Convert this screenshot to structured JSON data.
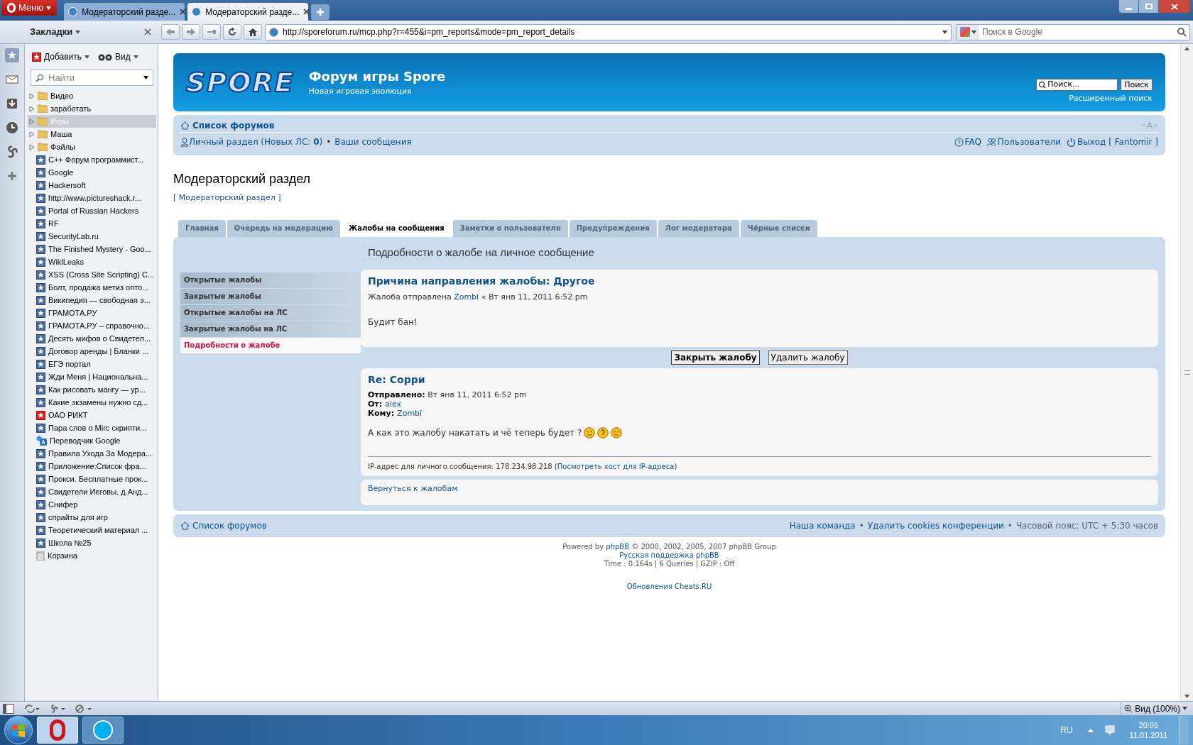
{
  "browser": {
    "menu": "Меню",
    "tabs": [
      {
        "title": "Модераторский разде...",
        "selected": false
      },
      {
        "title": "Модераторский разде...",
        "selected": true
      }
    ],
    "address": "http://sporeforum.ru/mcp.php?r=455&i=pm_reports&mode=pm_report_details",
    "search_placeholder": "Поиск в Google"
  },
  "sidebar": {
    "title": "Закладки",
    "add": "Добавить",
    "view": "Вид",
    "search_placeholder": "Найти",
    "items": [
      {
        "kind": "folder",
        "label": "Видео",
        "selected": false
      },
      {
        "kind": "folder",
        "label": "заработать",
        "selected": false
      },
      {
        "kind": "folder",
        "label": "Игры",
        "selected": true
      },
      {
        "kind": "folder",
        "label": "Маша",
        "selected": false
      },
      {
        "kind": "folder",
        "label": "Файлы",
        "selected": false
      },
      {
        "kind": "bookmark",
        "label": "C++ Форум программист...",
        "selected": false
      },
      {
        "kind": "bookmark",
        "label": "Google",
        "selected": false
      },
      {
        "kind": "bookmark",
        "label": "Hackersoft",
        "selected": false
      },
      {
        "kind": "bookmark",
        "label": "http://www.pictureshack.r...",
        "selected": false
      },
      {
        "kind": "bookmark",
        "label": "Portal of Russian Hackers",
        "selected": false
      },
      {
        "kind": "bookmark",
        "label": "RF",
        "selected": false
      },
      {
        "kind": "bookmark",
        "label": "SecurityLab.ru",
        "selected": false
      },
      {
        "kind": "bookmark",
        "label": "The Finished Mystery - Goo...",
        "selected": false
      },
      {
        "kind": "bookmark",
        "label": "WikiLeaks",
        "selected": false
      },
      {
        "kind": "bookmark",
        "label": "XSS (Cross Site Scripting) C...",
        "selected": false
      },
      {
        "kind": "bookmark",
        "label": "Болт, продажа метиз опто...",
        "selected": false
      },
      {
        "kind": "bookmark",
        "label": "Википедия — свободная э...",
        "selected": false
      },
      {
        "kind": "bookmark",
        "label": "ГРАМОТА.РУ",
        "selected": false
      },
      {
        "kind": "bookmark",
        "label": "ГРАМОТА.РУ – справочно...",
        "selected": false
      },
      {
        "kind": "bookmark",
        "label": "Десять мифов о Свидетел...",
        "selected": false
      },
      {
        "kind": "bookmark",
        "label": "Договор аренды | Бланки ...",
        "selected": false
      },
      {
        "kind": "bookmark",
        "label": "ЕГЭ портал",
        "selected": false
      },
      {
        "kind": "bookmark",
        "label": "Жди Меня | Национальна...",
        "selected": false
      },
      {
        "kind": "bookmark",
        "label": "Как рисовать мангу — ур...",
        "selected": false
      },
      {
        "kind": "bookmark",
        "label": "Какие экзамены нужно сд...",
        "selected": false
      },
      {
        "kind": "red",
        "label": "ОАО РИКТ",
        "selected": false
      },
      {
        "kind": "bookmark",
        "label": "Пара слов о Mirc скрипти...",
        "selected": false
      },
      {
        "kind": "translate",
        "label": "Переводчик Google",
        "selected": false
      },
      {
        "kind": "bookmark",
        "label": "Правила Ухода За Модера...",
        "selected": false
      },
      {
        "kind": "bookmark",
        "label": "Приложение:Список фра...",
        "selected": false
      },
      {
        "kind": "bookmark",
        "label": "Прокси. Бесплатные прок...",
        "selected": false
      },
      {
        "kind": "bookmark",
        "label": "Свидетели Иеговы. д.Анд...",
        "selected": false
      },
      {
        "kind": "bookmark",
        "label": "Снифер",
        "selected": false
      },
      {
        "kind": "bookmark",
        "label": "спрайты для игр",
        "selected": false
      },
      {
        "kind": "bookmark",
        "label": "Теоретический материал ...",
        "selected": false
      },
      {
        "kind": "bookmark",
        "label": "Школа №25",
        "selected": false
      },
      {
        "kind": "trash",
        "label": "Корзина",
        "selected": false
      }
    ]
  },
  "forum": {
    "logo": "SPORE",
    "title": "Форум игры Spore",
    "subtitle": "Новая игровая эволюция",
    "search_placeholder": "Поиск...",
    "search_button": "Поиск",
    "advanced_search": "Расширенный поиск",
    "breadcrumb": "Список форумов",
    "font_size": "A",
    "separator": "•",
    "nav_left": [
      {
        "text": "Личный раздел (Новых ЛС: **0**)"
      },
      {
        "text": "Ваши сообщения"
      }
    ],
    "nav_right": [
      {
        "kind": "faq",
        "text": "FAQ"
      },
      {
        "kind": "users",
        "text": "Пользователи"
      },
      {
        "kind": "logout",
        "text": "Выход [ Fantomir ]"
      }
    ]
  },
  "page": {
    "title": "Модераторский раздел",
    "link": "[ Модераторский раздел ]",
    "tabs": [
      {
        "label": "Главная",
        "selected": false
      },
      {
        "label": "Очередь на модерацию",
        "selected": false
      },
      {
        "label": "Жалобы на сообщения",
        "selected": true
      },
      {
        "label": "Заметки о пользователе",
        "selected": false
      },
      {
        "label": "Предупреждения",
        "selected": false
      },
      {
        "label": "Лог модератора",
        "selected": false
      },
      {
        "label": "Чёрные списки",
        "selected": false
      }
    ],
    "menu": [
      {
        "label": "Открытые жалобы",
        "selected": false
      },
      {
        "label": "Закрытые жалобы",
        "selected": false
      },
      {
        "label": "Открытые жалобы на ЛС",
        "selected": false
      },
      {
        "label": "Закрытые жалобы на ЛС",
        "selected": false
      },
      {
        "label": "Подробности о жалобе",
        "selected": true
      }
    ],
    "heading": "Подробности о жалобе на личное сообщение",
    "report": {
      "title": "Причина направления жалобы: Другое",
      "meta_prefix": "Жалоба отправлена",
      "author": "Zombi",
      "date": "« Вт янв 11, 2011 6:52 pm",
      "body": "Будит бан!"
    },
    "buttons": [
      {
        "label": "Закрыть жалобу",
        "kind": "primary"
      },
      {
        "label": "Удалить жалобу",
        "kind": "secondary"
      }
    ],
    "message": {
      "title": "Re: Сорри",
      "sent_label": "Отправлено:",
      "sent": "Вт янв 11, 2011 6:52 pm",
      "from_label": "От:",
      "from": "aiex",
      "to_label": "Кому:",
      "to": "Zombi",
      "body": "А как это жалобу накатать и чё теперь будет ?",
      "ip_text": "IP-адрес для личного сообщения: 178.234.98.218 (",
      "ip_link": "Посмотреть хост для IP-адреса",
      "ip_end": ")"
    },
    "back": "Вернуться к жалобам"
  },
  "footer": {
    "breadcrumb": "Список форумов",
    "links": [
      "Наша команда",
      "Удалить cookies конференции"
    ],
    "separator": "•",
    "timezone": "Часовой пояс: UTC + 5:30 часов",
    "powered_prefix": "Powered by",
    "powered_link": "phpBB",
    "powered_suffix": "© 2000, 2002, 2005, 2007 phpBB Group",
    "support": "Русская поддержка phpBB",
    "stats": "Time : 0.164s | 6 Queries | GZIP : Off",
    "updates": "Обновления Cheats.RU"
  },
  "status": {
    "zoom": "Вид (100%)"
  },
  "taskbar": {
    "lang": "RU",
    "time": "20:05",
    "date": "11.01.2011"
  }
}
